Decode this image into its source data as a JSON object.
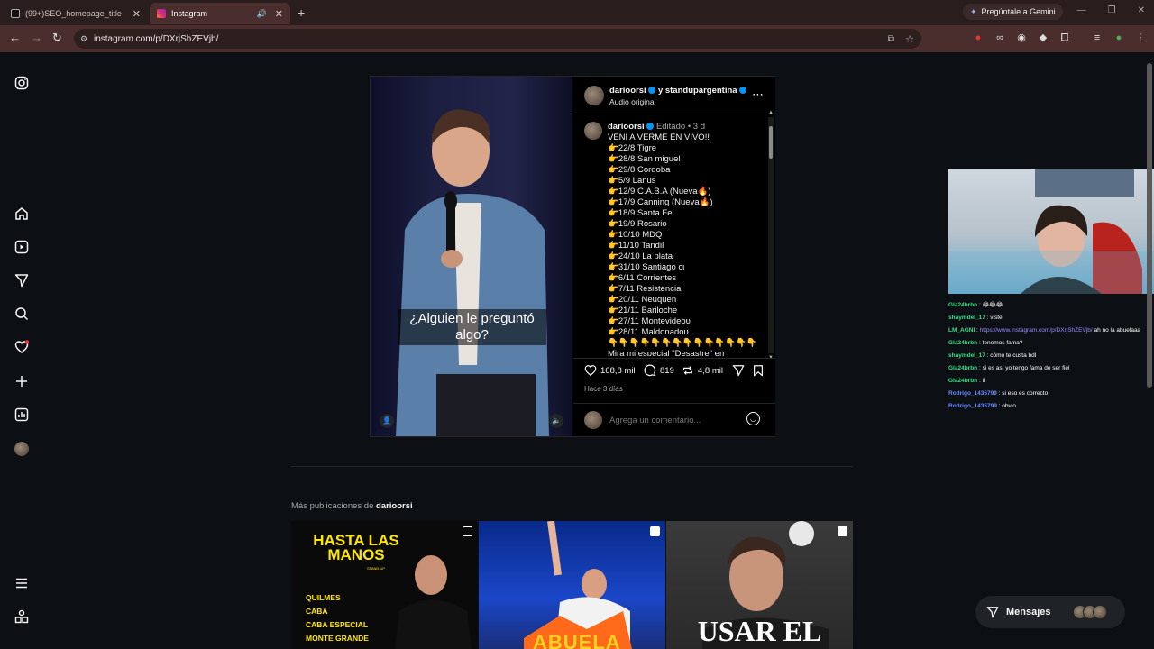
{
  "browser": {
    "tabs": [
      {
        "label": "(99+)SEO_homepage_title",
        "favicon_color": "#e0e0e0"
      },
      {
        "label": "Instagram",
        "favicon_color": "#e1306c"
      }
    ],
    "gemini_label": "Pregúntale a Gemini",
    "url": "instagram.com/p/DXrjShZEVjb/"
  },
  "post": {
    "caption_overlay": "¿Alguien le preguntó algo?",
    "header": {
      "user": "darioorsi",
      "collab": "y standupargentina",
      "audio": "Audio original"
    },
    "comment": {
      "user": "darioorsi",
      "edited": "Editado",
      "time": "3 d",
      "lines": [
        "VENI A VERME EN VIVO!!",
        "👉22/8 Tigre",
        "👉28/8 San miguel",
        "👉29/8 Cordoba",
        "👉5/9 Lanus",
        "👉12/9 C.A.B.A (Nueva🔥)",
        "👉17/9 Canning (Nueva🔥)",
        "👉18/9 Santa Fe",
        "👉19/9 Rosario",
        "👉10/10 MDQ",
        "👉11/10 Tandil",
        "👉24/10 La plata",
        "👉31/10 Santiago cι",
        "👉6/11 Corrientes",
        "👉7/11 Resistencia",
        "👉20/11 Neuquen",
        "👉21/11 Bariloche",
        "👉27/11 Montevideoυ",
        "👉28/11 Maldonadoυ",
        "👇👇👇👇👇👇👇👇👇👇👇👇👇👇",
        "Mira mi especial \"Desastre\" en"
      ]
    },
    "likes": "168,8 mil",
    "comments_count": "819",
    "reposts": "4,8 mil",
    "posted": "Hace 3 días",
    "comment_placeholder": "Agrega un comentario..."
  },
  "more": {
    "prefix": "Más publicaciones de",
    "user": "darioorsi",
    "thumb1": {
      "title": "HASTA LAS MANOS",
      "sub": "STAND UP",
      "cities": [
        "QUILMES",
        "CABA",
        "CABA ESPECIAL",
        "MONTE GRANDE"
      ]
    },
    "thumb2": {
      "text": "ABUELA"
    },
    "thumb3": {
      "text": "USAR EL"
    }
  },
  "chat": [
    {
      "user": "Gla24brbn",
      "color": "#3ddc84",
      "msg": "😂😂😂"
    },
    {
      "user": "shaymdel_17",
      "color": "#3ddc84",
      "msg": "viste"
    },
    {
      "user": "LM_AGNI",
      "color": "#3ddc84",
      "link": "https://www.instagram.com/p/DXrjShZEVjb/",
      "msg": "ah no la abuelaaa"
    },
    {
      "user": "Gla24brbn",
      "color": "#3ddc84",
      "msg": "tenemos fama?"
    },
    {
      "user": "shaymdel_17",
      "color": "#3ddc84",
      "msg": "cómo te custa bdl"
    },
    {
      "user": "Gla24brbn",
      "color": "#3ddc84",
      "msg": "si es así yo tengo fama de ser fiel"
    },
    {
      "user": "Gla24brbn",
      "color": "#3ddc84",
      "msg": "il"
    },
    {
      "user": "Rodrigo_1435799",
      "color": "#6b8cff",
      "msg": "si eso es correcto"
    },
    {
      "user": "Rodrigo_1435799",
      "color": "#6b8cff",
      "msg": "obvio"
    }
  ],
  "messages_label": "Mensajes"
}
